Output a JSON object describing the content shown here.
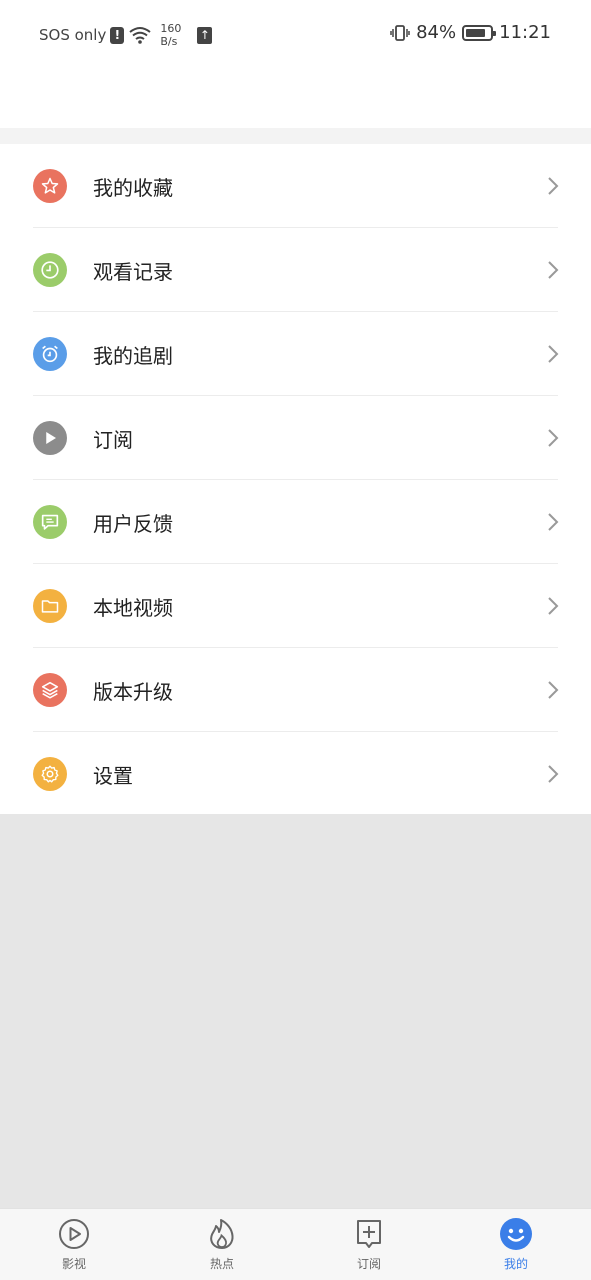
{
  "status_bar": {
    "carrier": "SOS only",
    "net_speed_value": "160",
    "net_speed_unit": "B/s",
    "battery": "84%",
    "time": "11:21"
  },
  "menu": {
    "items": [
      {
        "label": "我的收藏",
        "icon": "star-icon",
        "color": "#e9735f"
      },
      {
        "label": "观看记录",
        "icon": "clock-icon",
        "color": "#9bcc6a"
      },
      {
        "label": "我的追剧",
        "icon": "alarm-clock-icon",
        "color": "#5a9de8"
      },
      {
        "label": "订阅",
        "icon": "play-icon",
        "color": "#8c8c8c"
      },
      {
        "label": "用户反馈",
        "icon": "message-icon",
        "color": "#9bcc6a"
      },
      {
        "label": "本地视频",
        "icon": "folder-icon",
        "color": "#f3b140"
      },
      {
        "label": "版本升级",
        "icon": "layers-icon",
        "color": "#e9735f"
      },
      {
        "label": "设置",
        "icon": "gear-icon",
        "color": "#f3b140"
      }
    ]
  },
  "bottom_nav": {
    "items": [
      {
        "label": "影视",
        "icon": "video-play-icon",
        "active": false
      },
      {
        "label": "热点",
        "icon": "flame-icon",
        "active": false
      },
      {
        "label": "订阅",
        "icon": "add-box-icon",
        "active": false
      },
      {
        "label": "我的",
        "icon": "smiley-icon",
        "active": true
      }
    ],
    "active_color": "#3a7ee8"
  }
}
